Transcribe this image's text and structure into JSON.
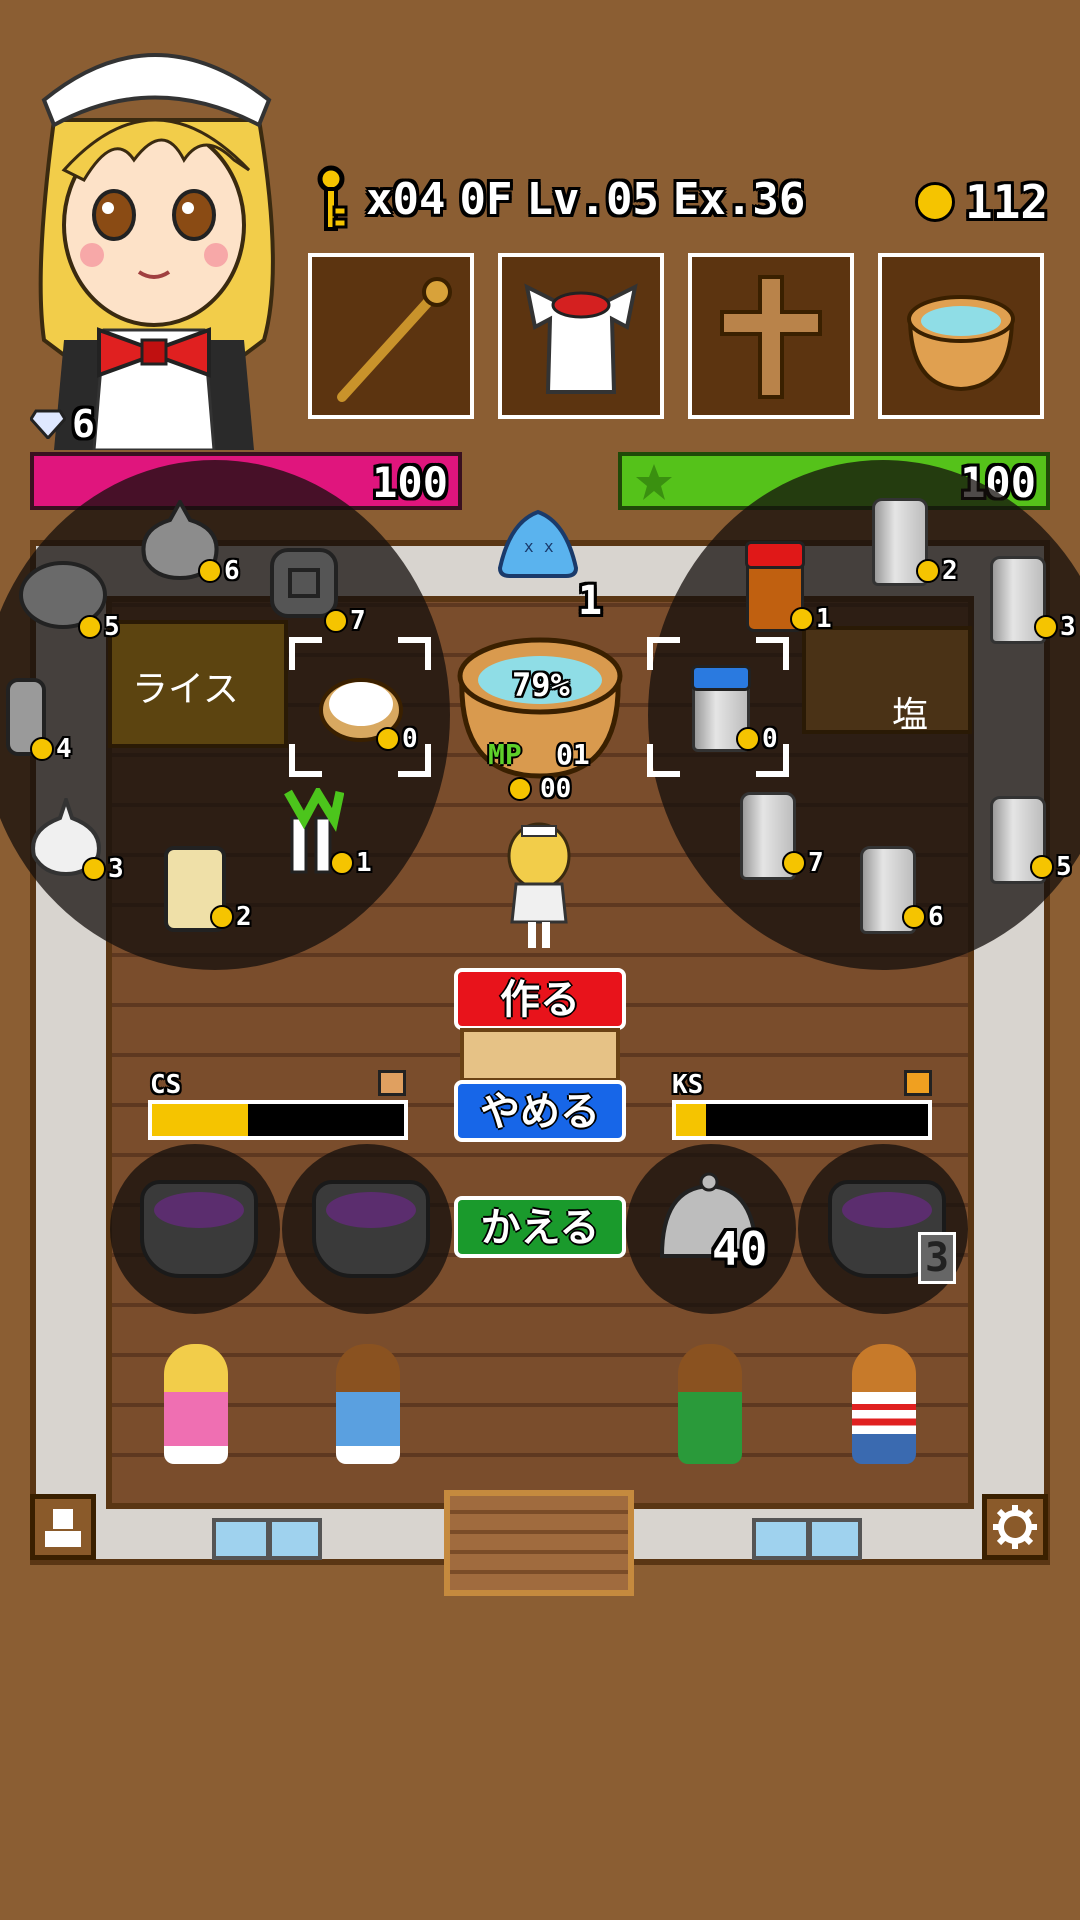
{
  "hud": {
    "key_label": "x04",
    "floor": "0F",
    "level": "Lv.05",
    "exp": "Ex.36",
    "coins": "112",
    "gems": "6",
    "hp_value": "100",
    "mp_value": "100"
  },
  "equipment": [
    {
      "name": "staff-icon"
    },
    {
      "name": "maid-apron-icon"
    },
    {
      "name": "cross-icon"
    },
    {
      "name": "pot-icon"
    }
  ],
  "slime_count": "1",
  "cauldron": {
    "percent": "79%",
    "mp_label": "MP",
    "mp_value": "01",
    "coin_value": "00"
  },
  "ingredients_left": [
    {
      "name": "onion",
      "count": "6"
    },
    {
      "name": "pan",
      "count": "5"
    },
    {
      "name": "jar",
      "count": "7"
    },
    {
      "name": "whisk",
      "count": "4"
    },
    {
      "name": "garlic",
      "count": "3"
    },
    {
      "name": "leek",
      "count": "1"
    },
    {
      "name": "bamboo",
      "count": "2"
    }
  ],
  "selected_left": {
    "label": "ライス",
    "count": "0"
  },
  "ingredients_right": [
    {
      "name": "jar-a",
      "count": "2"
    },
    {
      "name": "red-jar",
      "count": "1"
    },
    {
      "name": "jar-b",
      "count": "3"
    },
    {
      "name": "jar-c",
      "count": "7"
    },
    {
      "name": "jar-d",
      "count": "6"
    },
    {
      "name": "jar-e",
      "count": "5"
    }
  ],
  "selected_right": {
    "label": "塩",
    "count": "0"
  },
  "buttons": {
    "make": "作る",
    "stop": "やめる",
    "change": "かえる"
  },
  "gauges": {
    "cs_label": "CS",
    "cs_fill": 0.38,
    "ks_label": "KS",
    "ks_fill": 0.12
  },
  "pots": {
    "cloche_count": "40",
    "pot_count": "3"
  },
  "colors": {
    "hp": "#e0157d",
    "mp": "#55c21a",
    "make": "#e8131b",
    "stop": "#1766e8",
    "change": "#1a9a2c"
  }
}
